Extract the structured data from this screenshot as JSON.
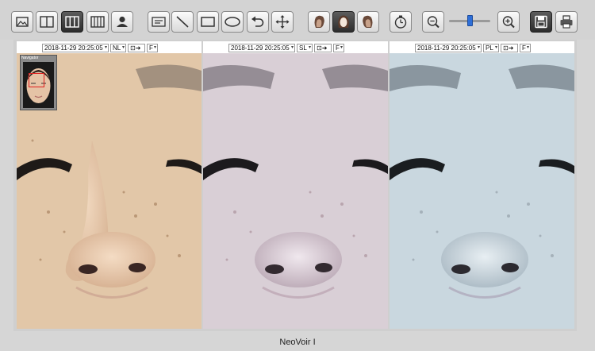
{
  "toolbar": {
    "buttons": [
      {
        "name": "image-icon"
      },
      {
        "name": "layout-two-panel-icon"
      },
      {
        "name": "layout-three-panel-icon",
        "active": true
      },
      {
        "name": "layout-four-panel-icon"
      },
      {
        "name": "patient-icon"
      },
      {
        "name": "text-annotation-icon"
      },
      {
        "name": "line-tool-icon"
      },
      {
        "name": "rectangle-tool-icon"
      },
      {
        "name": "ellipse-tool-icon"
      },
      {
        "name": "undo-icon"
      },
      {
        "name": "move-icon"
      },
      {
        "name": "face-left-icon"
      },
      {
        "name": "face-front-icon",
        "active": true
      },
      {
        "name": "face-right-icon"
      },
      {
        "name": "timer-icon"
      },
      {
        "name": "zoom-out-icon"
      },
      {
        "name": "zoom-in-icon"
      },
      {
        "name": "save-icon",
        "active": true
      },
      {
        "name": "print-icon"
      }
    ],
    "zoom_level": 0.5
  },
  "panels": [
    {
      "date": "2018-11-29 20:25:05",
      "mode": "NL",
      "view": "F",
      "tint": "#e2c7a8"
    },
    {
      "date": "2018-11-29 20:25:05",
      "mode": "SL",
      "view": "F",
      "tint": "#d9cfd6"
    },
    {
      "date": "2018-11-29 20:25:05",
      "mode": "PL",
      "view": "F",
      "tint": "#c9d7df"
    }
  ],
  "navigator": {
    "title": "Navigator"
  },
  "footer": {
    "brand": "NeoVoir I"
  }
}
